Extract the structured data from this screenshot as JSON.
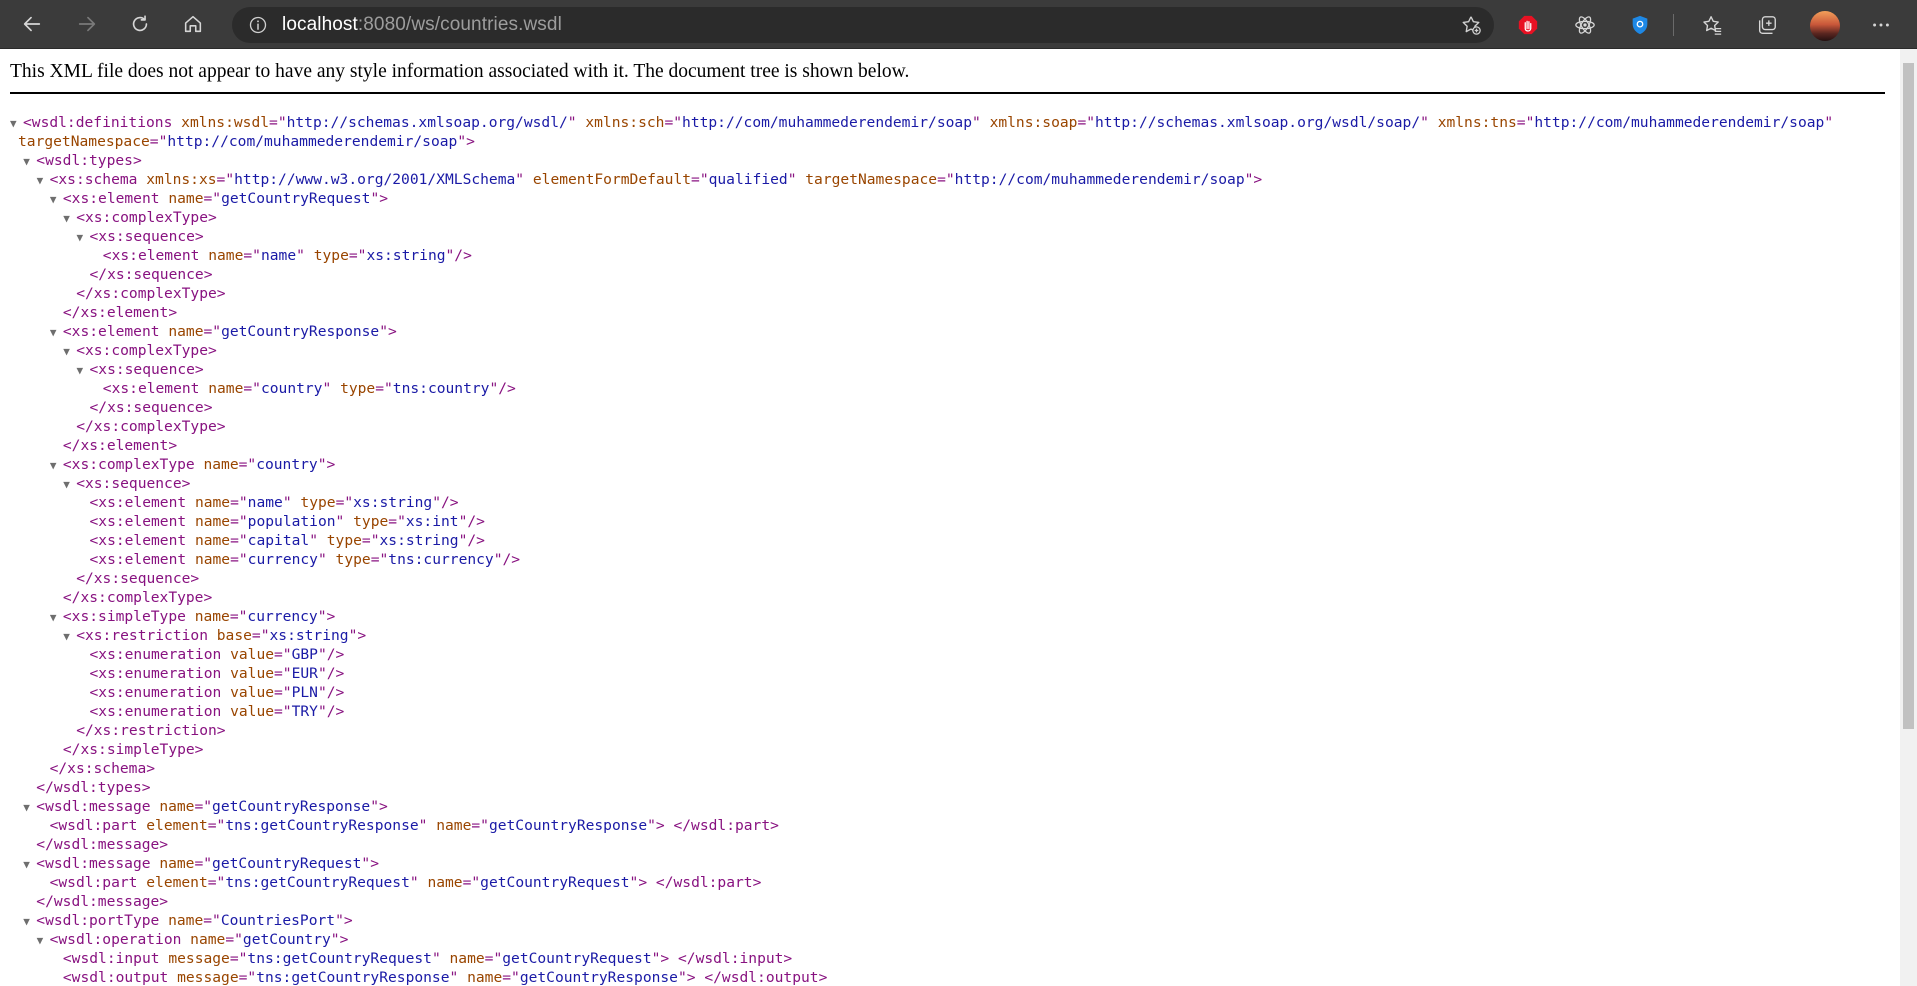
{
  "browser": {
    "url_host": "localhost",
    "url_rest": ":8080/ws/countries.wsdl",
    "icons": {
      "back": "arrow-left-icon",
      "forward": "arrow-right-icon",
      "refresh": "refresh-icon",
      "home": "home-icon",
      "info": "info-icon",
      "favorite": "star-add-icon",
      "ext1": "stop-hand-icon",
      "ext2": "react-atom-icon",
      "ext3": "shield-icon",
      "favorites": "favorites-star-icon",
      "collections": "collections-icon",
      "avatar": "profile-avatar",
      "menu": "more-dots-icon"
    },
    "colors": {
      "ext1": "#e81123",
      "ext3": "#1e88e5"
    }
  },
  "page": {
    "notice": "This XML file does not appear to have any style information associated with it. The document tree is shown below."
  },
  "xml_lines": [
    {
      "indent": 0,
      "toggle": true,
      "parts": [
        [
          "t",
          "<wsdl:definitions"
        ],
        [
          "a",
          " xmlns:wsdl"
        ],
        [
          "t",
          "=\""
        ],
        [
          "v",
          "http://schemas.xmlsoap.org/wsdl/"
        ],
        [
          "t",
          "\""
        ],
        [
          "a",
          " xmlns:sch"
        ],
        [
          "t",
          "=\""
        ],
        [
          "v",
          "http://com/muhammederendemir/soap"
        ],
        [
          "t",
          "\""
        ],
        [
          "a",
          " xmlns:soap"
        ],
        [
          "t",
          "=\""
        ],
        [
          "v",
          "http://schemas.xmlsoap.org/wsdl/soap/"
        ],
        [
          "t",
          "\""
        ],
        [
          "a",
          " xmlns:tns"
        ],
        [
          "t",
          "=\""
        ],
        [
          "v",
          "http://com/muhammederendemir/soap"
        ],
        [
          "t",
          "\""
        ]
      ]
    },
    {
      "indent": 0,
      "toggle": false,
      "cont": true,
      "parts": [
        [
          "a",
          "targetNamespace"
        ],
        [
          "t",
          "=\""
        ],
        [
          "v",
          "http://com/muhammederendemir/soap"
        ],
        [
          "t",
          "\">"
        ]
      ]
    },
    {
      "indent": 1,
      "toggle": true,
      "parts": [
        [
          "t",
          "<wsdl:types>"
        ]
      ]
    },
    {
      "indent": 2,
      "toggle": true,
      "parts": [
        [
          "t",
          "<xs:schema"
        ],
        [
          "a",
          " xmlns:xs"
        ],
        [
          "t",
          "=\""
        ],
        [
          "v",
          "http://www.w3.org/2001/XMLSchema"
        ],
        [
          "t",
          "\""
        ],
        [
          "a",
          " elementFormDefault"
        ],
        [
          "t",
          "=\""
        ],
        [
          "v",
          "qualified"
        ],
        [
          "t",
          "\""
        ],
        [
          "a",
          " targetNamespace"
        ],
        [
          "t",
          "=\""
        ],
        [
          "v",
          "http://com/muhammederendemir/soap"
        ],
        [
          "t",
          "\">"
        ]
      ]
    },
    {
      "indent": 3,
      "toggle": true,
      "parts": [
        [
          "t",
          "<xs:element"
        ],
        [
          "a",
          " name"
        ],
        [
          "t",
          "=\""
        ],
        [
          "v",
          "getCountryRequest"
        ],
        [
          "t",
          "\">"
        ]
      ]
    },
    {
      "indent": 4,
      "toggle": true,
      "parts": [
        [
          "t",
          "<xs:complexType>"
        ]
      ]
    },
    {
      "indent": 5,
      "toggle": true,
      "parts": [
        [
          "t",
          "<xs:sequence>"
        ]
      ]
    },
    {
      "indent": 6,
      "toggle": false,
      "parts": [
        [
          "t",
          "<xs:element"
        ],
        [
          "a",
          " name"
        ],
        [
          "t",
          "=\""
        ],
        [
          "v",
          "name"
        ],
        [
          "t",
          "\""
        ],
        [
          "a",
          " type"
        ],
        [
          "t",
          "=\""
        ],
        [
          "v",
          "xs:string"
        ],
        [
          "t",
          "\"/>"
        ]
      ]
    },
    {
      "indent": 5,
      "toggle": false,
      "parts": [
        [
          "t",
          "</xs:sequence>"
        ]
      ]
    },
    {
      "indent": 4,
      "toggle": false,
      "parts": [
        [
          "t",
          "</xs:complexType>"
        ]
      ]
    },
    {
      "indent": 3,
      "toggle": false,
      "parts": [
        [
          "t",
          "</xs:element>"
        ]
      ]
    },
    {
      "indent": 3,
      "toggle": true,
      "parts": [
        [
          "t",
          "<xs:element"
        ],
        [
          "a",
          " name"
        ],
        [
          "t",
          "=\""
        ],
        [
          "v",
          "getCountryResponse"
        ],
        [
          "t",
          "\">"
        ]
      ]
    },
    {
      "indent": 4,
      "toggle": true,
      "parts": [
        [
          "t",
          "<xs:complexType>"
        ]
      ]
    },
    {
      "indent": 5,
      "toggle": true,
      "parts": [
        [
          "t",
          "<xs:sequence>"
        ]
      ]
    },
    {
      "indent": 6,
      "toggle": false,
      "parts": [
        [
          "t",
          "<xs:element"
        ],
        [
          "a",
          " name"
        ],
        [
          "t",
          "=\""
        ],
        [
          "v",
          "country"
        ],
        [
          "t",
          "\""
        ],
        [
          "a",
          " type"
        ],
        [
          "t",
          "=\""
        ],
        [
          "v",
          "tns:country"
        ],
        [
          "t",
          "\"/>"
        ]
      ]
    },
    {
      "indent": 5,
      "toggle": false,
      "parts": [
        [
          "t",
          "</xs:sequence>"
        ]
      ]
    },
    {
      "indent": 4,
      "toggle": false,
      "parts": [
        [
          "t",
          "</xs:complexType>"
        ]
      ]
    },
    {
      "indent": 3,
      "toggle": false,
      "parts": [
        [
          "t",
          "</xs:element>"
        ]
      ]
    },
    {
      "indent": 3,
      "toggle": true,
      "parts": [
        [
          "t",
          "<xs:complexType"
        ],
        [
          "a",
          " name"
        ],
        [
          "t",
          "=\""
        ],
        [
          "v",
          "country"
        ],
        [
          "t",
          "\">"
        ]
      ]
    },
    {
      "indent": 4,
      "toggle": true,
      "parts": [
        [
          "t",
          "<xs:sequence>"
        ]
      ]
    },
    {
      "indent": 5,
      "toggle": false,
      "parts": [
        [
          "t",
          "<xs:element"
        ],
        [
          "a",
          " name"
        ],
        [
          "t",
          "=\""
        ],
        [
          "v",
          "name"
        ],
        [
          "t",
          "\""
        ],
        [
          "a",
          " type"
        ],
        [
          "t",
          "=\""
        ],
        [
          "v",
          "xs:string"
        ],
        [
          "t",
          "\"/>"
        ]
      ]
    },
    {
      "indent": 5,
      "toggle": false,
      "parts": [
        [
          "t",
          "<xs:element"
        ],
        [
          "a",
          " name"
        ],
        [
          "t",
          "=\""
        ],
        [
          "v",
          "population"
        ],
        [
          "t",
          "\""
        ],
        [
          "a",
          " type"
        ],
        [
          "t",
          "=\""
        ],
        [
          "v",
          "xs:int"
        ],
        [
          "t",
          "\"/>"
        ]
      ]
    },
    {
      "indent": 5,
      "toggle": false,
      "parts": [
        [
          "t",
          "<xs:element"
        ],
        [
          "a",
          " name"
        ],
        [
          "t",
          "=\""
        ],
        [
          "v",
          "capital"
        ],
        [
          "t",
          "\""
        ],
        [
          "a",
          " type"
        ],
        [
          "t",
          "=\""
        ],
        [
          "v",
          "xs:string"
        ],
        [
          "t",
          "\"/>"
        ]
      ]
    },
    {
      "indent": 5,
      "toggle": false,
      "parts": [
        [
          "t",
          "<xs:element"
        ],
        [
          "a",
          " name"
        ],
        [
          "t",
          "=\""
        ],
        [
          "v",
          "currency"
        ],
        [
          "t",
          "\""
        ],
        [
          "a",
          " type"
        ],
        [
          "t",
          "=\""
        ],
        [
          "v",
          "tns:currency"
        ],
        [
          "t",
          "\"/>"
        ]
      ]
    },
    {
      "indent": 4,
      "toggle": false,
      "parts": [
        [
          "t",
          "</xs:sequence>"
        ]
      ]
    },
    {
      "indent": 3,
      "toggle": false,
      "parts": [
        [
          "t",
          "</xs:complexType>"
        ]
      ]
    },
    {
      "indent": 3,
      "toggle": true,
      "parts": [
        [
          "t",
          "<xs:simpleType"
        ],
        [
          "a",
          " name"
        ],
        [
          "t",
          "=\""
        ],
        [
          "v",
          "currency"
        ],
        [
          "t",
          "\">"
        ]
      ]
    },
    {
      "indent": 4,
      "toggle": true,
      "parts": [
        [
          "t",
          "<xs:restriction"
        ],
        [
          "a",
          " base"
        ],
        [
          "t",
          "=\""
        ],
        [
          "v",
          "xs:string"
        ],
        [
          "t",
          "\">"
        ]
      ]
    },
    {
      "indent": 5,
      "toggle": false,
      "parts": [
        [
          "t",
          "<xs:enumeration"
        ],
        [
          "a",
          " value"
        ],
        [
          "t",
          "=\""
        ],
        [
          "v",
          "GBP"
        ],
        [
          "t",
          "\"/>"
        ]
      ]
    },
    {
      "indent": 5,
      "toggle": false,
      "parts": [
        [
          "t",
          "<xs:enumeration"
        ],
        [
          "a",
          " value"
        ],
        [
          "t",
          "=\""
        ],
        [
          "v",
          "EUR"
        ],
        [
          "t",
          "\"/>"
        ]
      ]
    },
    {
      "indent": 5,
      "toggle": false,
      "parts": [
        [
          "t",
          "<xs:enumeration"
        ],
        [
          "a",
          " value"
        ],
        [
          "t",
          "=\""
        ],
        [
          "v",
          "PLN"
        ],
        [
          "t",
          "\"/>"
        ]
      ]
    },
    {
      "indent": 5,
      "toggle": false,
      "parts": [
        [
          "t",
          "<xs:enumeration"
        ],
        [
          "a",
          " value"
        ],
        [
          "t",
          "=\""
        ],
        [
          "v",
          "TRY"
        ],
        [
          "t",
          "\"/>"
        ]
      ]
    },
    {
      "indent": 4,
      "toggle": false,
      "parts": [
        [
          "t",
          "</xs:restriction>"
        ]
      ]
    },
    {
      "indent": 3,
      "toggle": false,
      "parts": [
        [
          "t",
          "</xs:simpleType>"
        ]
      ]
    },
    {
      "indent": 2,
      "toggle": false,
      "parts": [
        [
          "t",
          "</xs:schema>"
        ]
      ]
    },
    {
      "indent": 1,
      "toggle": false,
      "parts": [
        [
          "t",
          "</wsdl:types>"
        ]
      ]
    },
    {
      "indent": 1,
      "toggle": true,
      "parts": [
        [
          "t",
          "<wsdl:message"
        ],
        [
          "a",
          " name"
        ],
        [
          "t",
          "=\""
        ],
        [
          "v",
          "getCountryResponse"
        ],
        [
          "t",
          "\">"
        ]
      ]
    },
    {
      "indent": 2,
      "toggle": false,
      "parts": [
        [
          "t",
          "<wsdl:part"
        ],
        [
          "a",
          " element"
        ],
        [
          "t",
          "=\""
        ],
        [
          "v",
          "tns:getCountryResponse"
        ],
        [
          "t",
          "\""
        ],
        [
          "a",
          " name"
        ],
        [
          "t",
          "=\""
        ],
        [
          "v",
          "getCountryResponse"
        ],
        [
          "t",
          "\">"
        ],
        [
          "x",
          " "
        ],
        [
          "t",
          "</wsdl:part>"
        ]
      ]
    },
    {
      "indent": 1,
      "toggle": false,
      "parts": [
        [
          "t",
          "</wsdl:message>"
        ]
      ]
    },
    {
      "indent": 1,
      "toggle": true,
      "parts": [
        [
          "t",
          "<wsdl:message"
        ],
        [
          "a",
          " name"
        ],
        [
          "t",
          "=\""
        ],
        [
          "v",
          "getCountryRequest"
        ],
        [
          "t",
          "\">"
        ]
      ]
    },
    {
      "indent": 2,
      "toggle": false,
      "parts": [
        [
          "t",
          "<wsdl:part"
        ],
        [
          "a",
          " element"
        ],
        [
          "t",
          "=\""
        ],
        [
          "v",
          "tns:getCountryRequest"
        ],
        [
          "t",
          "\""
        ],
        [
          "a",
          " name"
        ],
        [
          "t",
          "=\""
        ],
        [
          "v",
          "getCountryRequest"
        ],
        [
          "t",
          "\">"
        ],
        [
          "x",
          " "
        ],
        [
          "t",
          "</wsdl:part>"
        ]
      ]
    },
    {
      "indent": 1,
      "toggle": false,
      "parts": [
        [
          "t",
          "</wsdl:message>"
        ]
      ]
    },
    {
      "indent": 1,
      "toggle": true,
      "parts": [
        [
          "t",
          "<wsdl:portType"
        ],
        [
          "a",
          " name"
        ],
        [
          "t",
          "=\""
        ],
        [
          "v",
          "CountriesPort"
        ],
        [
          "t",
          "\">"
        ]
      ]
    },
    {
      "indent": 2,
      "toggle": true,
      "parts": [
        [
          "t",
          "<wsdl:operation"
        ],
        [
          "a",
          " name"
        ],
        [
          "t",
          "=\""
        ],
        [
          "v",
          "getCountry"
        ],
        [
          "t",
          "\">"
        ]
      ]
    },
    {
      "indent": 3,
      "toggle": false,
      "parts": [
        [
          "t",
          "<wsdl:input"
        ],
        [
          "a",
          " message"
        ],
        [
          "t",
          "=\""
        ],
        [
          "v",
          "tns:getCountryRequest"
        ],
        [
          "t",
          "\""
        ],
        [
          "a",
          " name"
        ],
        [
          "t",
          "=\""
        ],
        [
          "v",
          "getCountryRequest"
        ],
        [
          "t",
          "\">"
        ],
        [
          "x",
          " "
        ],
        [
          "t",
          "</wsdl:input>"
        ]
      ]
    },
    {
      "indent": 3,
      "toggle": false,
      "parts": [
        [
          "t",
          "<wsdl:output"
        ],
        [
          "a",
          " message"
        ],
        [
          "t",
          "=\""
        ],
        [
          "v",
          "tns:getCountryResponse"
        ],
        [
          "t",
          "\""
        ],
        [
          "a",
          " name"
        ],
        [
          "t",
          "=\""
        ],
        [
          "v",
          "getCountryResponse"
        ],
        [
          "t",
          "\">"
        ],
        [
          "x",
          " "
        ],
        [
          "t",
          "</wsdl:output>"
        ]
      ]
    }
  ]
}
